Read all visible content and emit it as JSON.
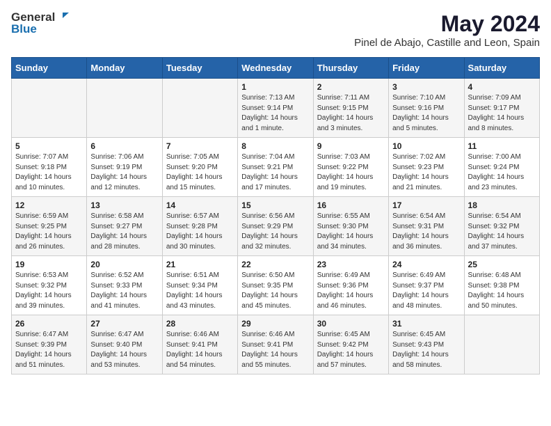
{
  "header": {
    "logo_general": "General",
    "logo_blue": "Blue",
    "title": "May 2024",
    "subtitle": "Pinel de Abajo, Castille and Leon, Spain"
  },
  "columns": [
    "Sunday",
    "Monday",
    "Tuesday",
    "Wednesday",
    "Thursday",
    "Friday",
    "Saturday"
  ],
  "weeks": [
    {
      "cells": [
        {
          "day": "",
          "text": ""
        },
        {
          "day": "",
          "text": ""
        },
        {
          "day": "",
          "text": ""
        },
        {
          "day": "1",
          "text": "Sunrise: 7:13 AM\nSunset: 9:14 PM\nDaylight: 14 hours\nand 1 minute."
        },
        {
          "day": "2",
          "text": "Sunrise: 7:11 AM\nSunset: 9:15 PM\nDaylight: 14 hours\nand 3 minutes."
        },
        {
          "day": "3",
          "text": "Sunrise: 7:10 AM\nSunset: 9:16 PM\nDaylight: 14 hours\nand 5 minutes."
        },
        {
          "day": "4",
          "text": "Sunrise: 7:09 AM\nSunset: 9:17 PM\nDaylight: 14 hours\nand 8 minutes."
        }
      ]
    },
    {
      "cells": [
        {
          "day": "5",
          "text": "Sunrise: 7:07 AM\nSunset: 9:18 PM\nDaylight: 14 hours\nand 10 minutes."
        },
        {
          "day": "6",
          "text": "Sunrise: 7:06 AM\nSunset: 9:19 PM\nDaylight: 14 hours\nand 12 minutes."
        },
        {
          "day": "7",
          "text": "Sunrise: 7:05 AM\nSunset: 9:20 PM\nDaylight: 14 hours\nand 15 minutes."
        },
        {
          "day": "8",
          "text": "Sunrise: 7:04 AM\nSunset: 9:21 PM\nDaylight: 14 hours\nand 17 minutes."
        },
        {
          "day": "9",
          "text": "Sunrise: 7:03 AM\nSunset: 9:22 PM\nDaylight: 14 hours\nand 19 minutes."
        },
        {
          "day": "10",
          "text": "Sunrise: 7:02 AM\nSunset: 9:23 PM\nDaylight: 14 hours\nand 21 minutes."
        },
        {
          "day": "11",
          "text": "Sunrise: 7:00 AM\nSunset: 9:24 PM\nDaylight: 14 hours\nand 23 minutes."
        }
      ]
    },
    {
      "cells": [
        {
          "day": "12",
          "text": "Sunrise: 6:59 AM\nSunset: 9:25 PM\nDaylight: 14 hours\nand 26 minutes."
        },
        {
          "day": "13",
          "text": "Sunrise: 6:58 AM\nSunset: 9:27 PM\nDaylight: 14 hours\nand 28 minutes."
        },
        {
          "day": "14",
          "text": "Sunrise: 6:57 AM\nSunset: 9:28 PM\nDaylight: 14 hours\nand 30 minutes."
        },
        {
          "day": "15",
          "text": "Sunrise: 6:56 AM\nSunset: 9:29 PM\nDaylight: 14 hours\nand 32 minutes."
        },
        {
          "day": "16",
          "text": "Sunrise: 6:55 AM\nSunset: 9:30 PM\nDaylight: 14 hours\nand 34 minutes."
        },
        {
          "day": "17",
          "text": "Sunrise: 6:54 AM\nSunset: 9:31 PM\nDaylight: 14 hours\nand 36 minutes."
        },
        {
          "day": "18",
          "text": "Sunrise: 6:54 AM\nSunset: 9:32 PM\nDaylight: 14 hours\nand 37 minutes."
        }
      ]
    },
    {
      "cells": [
        {
          "day": "19",
          "text": "Sunrise: 6:53 AM\nSunset: 9:32 PM\nDaylight: 14 hours\nand 39 minutes."
        },
        {
          "day": "20",
          "text": "Sunrise: 6:52 AM\nSunset: 9:33 PM\nDaylight: 14 hours\nand 41 minutes."
        },
        {
          "day": "21",
          "text": "Sunrise: 6:51 AM\nSunset: 9:34 PM\nDaylight: 14 hours\nand 43 minutes."
        },
        {
          "day": "22",
          "text": "Sunrise: 6:50 AM\nSunset: 9:35 PM\nDaylight: 14 hours\nand 45 minutes."
        },
        {
          "day": "23",
          "text": "Sunrise: 6:49 AM\nSunset: 9:36 PM\nDaylight: 14 hours\nand 46 minutes."
        },
        {
          "day": "24",
          "text": "Sunrise: 6:49 AM\nSunset: 9:37 PM\nDaylight: 14 hours\nand 48 minutes."
        },
        {
          "day": "25",
          "text": "Sunrise: 6:48 AM\nSunset: 9:38 PM\nDaylight: 14 hours\nand 50 minutes."
        }
      ]
    },
    {
      "cells": [
        {
          "day": "26",
          "text": "Sunrise: 6:47 AM\nSunset: 9:39 PM\nDaylight: 14 hours\nand 51 minutes."
        },
        {
          "day": "27",
          "text": "Sunrise: 6:47 AM\nSunset: 9:40 PM\nDaylight: 14 hours\nand 53 minutes."
        },
        {
          "day": "28",
          "text": "Sunrise: 6:46 AM\nSunset: 9:41 PM\nDaylight: 14 hours\nand 54 minutes."
        },
        {
          "day": "29",
          "text": "Sunrise: 6:46 AM\nSunset: 9:41 PM\nDaylight: 14 hours\nand 55 minutes."
        },
        {
          "day": "30",
          "text": "Sunrise: 6:45 AM\nSunset: 9:42 PM\nDaylight: 14 hours\nand 57 minutes."
        },
        {
          "day": "31",
          "text": "Sunrise: 6:45 AM\nSunset: 9:43 PM\nDaylight: 14 hours\nand 58 minutes."
        },
        {
          "day": "",
          "text": ""
        }
      ]
    }
  ]
}
